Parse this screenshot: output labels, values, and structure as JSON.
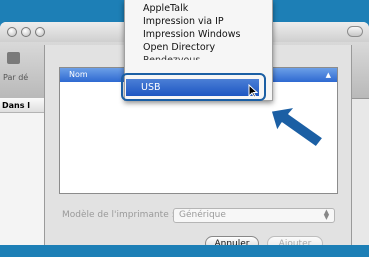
{
  "window": {
    "toolbar_label": "Par dé",
    "side_column_header": "Dans l"
  },
  "list": {
    "column_header": "Nom"
  },
  "model": {
    "label": "Modèle de l'imprimante :",
    "value": "Générique"
  },
  "buttons": {
    "cancel": "Annuler",
    "add": "Ajouter"
  },
  "menu": {
    "items": [
      "AppleTalk",
      "Impression via IP",
      "Impression Windows",
      "Open Directory",
      "Rendezvous"
    ],
    "selected": "USB"
  },
  "colors": {
    "desktop": "#1d7fb6",
    "highlight": "#2f6ad1",
    "annotation": "#1b5fa4"
  }
}
